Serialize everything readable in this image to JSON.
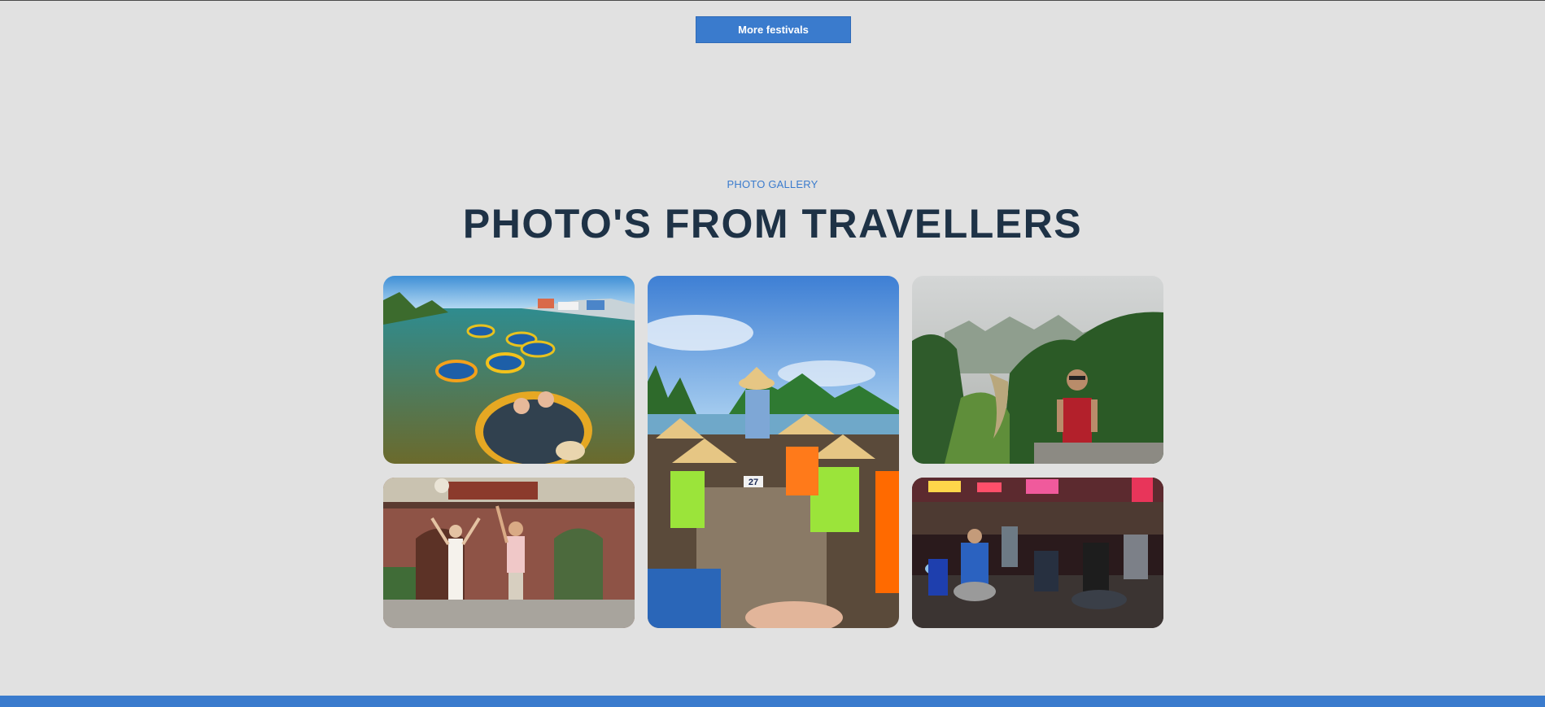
{
  "actions": {
    "more_festivals_label": "More festivals"
  },
  "gallery": {
    "eyebrow": "PHOTO GALLERY",
    "title": "PHOTO'S FROM TRAVELLERS",
    "photos": [
      {
        "subject": "basket-boats-river",
        "boat_number": ""
      },
      {
        "subject": "boat-tour-halong-bay",
        "boat_number": "27"
      },
      {
        "subject": "mountain-valley-hiker",
        "boat_number": ""
      },
      {
        "subject": "couple-at-temple-gate",
        "boat_number": ""
      },
      {
        "subject": "night-street-scooters",
        "boat_number": ""
      }
    ]
  },
  "colors": {
    "accent": "#3a7bcd",
    "heading": "#1e3246",
    "background": "#e1e1e1"
  }
}
